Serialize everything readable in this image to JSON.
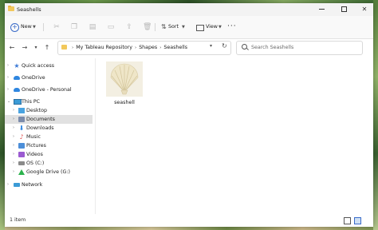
{
  "window": {
    "title": "Seashells"
  },
  "commandbar": {
    "new_label": "New",
    "sort_label": "Sort",
    "view_label": "View",
    "more_label": "···"
  },
  "address": {
    "crumbs": [
      "My Tableau Repository",
      "Shapes",
      "Seashells"
    ],
    "search_placeholder": "Search Seashells"
  },
  "sidebar": {
    "items": [
      {
        "label": "Quick access"
      },
      {
        "label": "OneDrive"
      },
      {
        "label": "OneDrive - Personal"
      },
      {
        "label": "This PC"
      },
      {
        "label": "Desktop"
      },
      {
        "label": "Documents"
      },
      {
        "label": "Downloads"
      },
      {
        "label": "Music"
      },
      {
        "label": "Pictures"
      },
      {
        "label": "Videos"
      },
      {
        "label": "OS (C:)"
      },
      {
        "label": "Google Drive (G:)"
      },
      {
        "label": "Network"
      }
    ],
    "selected": "Documents"
  },
  "files": [
    {
      "name": "seashell"
    }
  ],
  "status": {
    "item_count": "1 item"
  },
  "colors": {
    "accent": "#3a6bc8",
    "selection": "#e1e1e1",
    "folder": "#f2c85b"
  }
}
